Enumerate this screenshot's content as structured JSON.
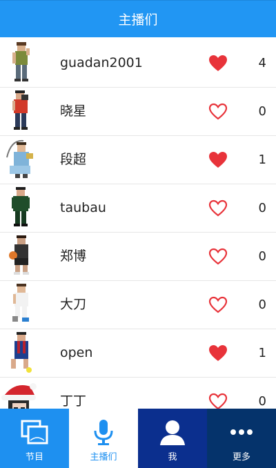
{
  "header": {
    "title": "主播们"
  },
  "anchors": [
    {
      "name": "guadan2001",
      "liked": true,
      "count": "4",
      "avatar": "pixel-man-olive-icon"
    },
    {
      "name": "晓星",
      "liked": false,
      "count": "0",
      "avatar": "pixel-man-camera-icon"
    },
    {
      "name": "段超",
      "liked": true,
      "count": "1",
      "avatar": "pixel-warrior-icon"
    },
    {
      "name": "taubau",
      "liked": false,
      "count": "0",
      "avatar": "pixel-soldier-icon"
    },
    {
      "name": "郑博",
      "liked": false,
      "count": "0",
      "avatar": "pixel-basketball-icon"
    },
    {
      "name": "大刀",
      "liked": false,
      "count": "0",
      "avatar": "pixel-man-white-icon"
    },
    {
      "name": "open",
      "liked": true,
      "count": "1",
      "avatar": "pixel-footballer-icon"
    },
    {
      "name": "丁丁",
      "liked": false,
      "count": "0",
      "avatar": "santa-hat-girl-icon"
    }
  ],
  "tabs": [
    {
      "label": "节目",
      "icon": "programs-icon"
    },
    {
      "label": "主播们",
      "icon": "microphone-icon"
    },
    {
      "label": "我",
      "icon": "person-icon"
    },
    {
      "label": "更多",
      "icon": "more-dots-icon"
    }
  ],
  "colors": {
    "header": "#2196f3",
    "heart": "#e8333a",
    "tab_programs": "#1e90f0",
    "tab_anchors_active": "#ffffff",
    "tab_me": "#0b2f8e",
    "tab_more": "#05336b"
  }
}
